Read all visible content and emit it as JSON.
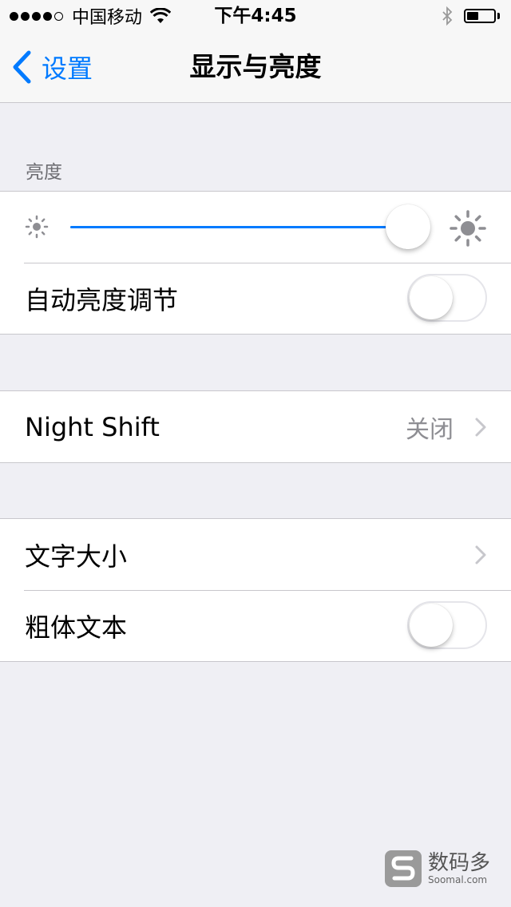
{
  "status_bar": {
    "signal_bars_filled": 4,
    "signal_bars_total": 5,
    "carrier": "中国移动",
    "time": "下午4:45",
    "battery_level": 0.45
  },
  "nav": {
    "back_label": "设置",
    "title": "显示与亮度"
  },
  "brightness": {
    "section_header": "亮度",
    "level": 0.94,
    "auto_label": "自动亮度调节",
    "auto_on": false
  },
  "night_shift": {
    "label": "Night Shift",
    "value": "关闭"
  },
  "text": {
    "size_label": "文字大小",
    "bold_label": "粗体文本",
    "bold_on": false
  },
  "watermark": {
    "title": "数码多",
    "subtitle": "Soomal.com"
  },
  "colors": {
    "accent": "#007aff",
    "background": "#efeff4",
    "separator": "#c8c7cc",
    "secondary_text": "#8e8e93"
  }
}
